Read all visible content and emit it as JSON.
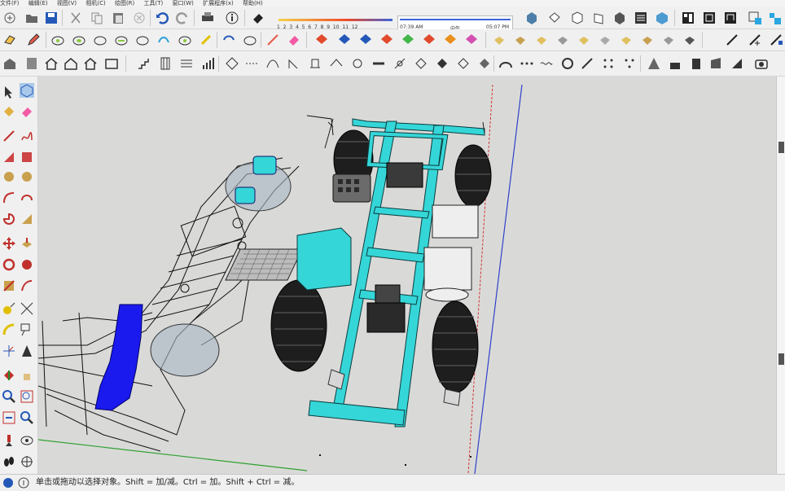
{
  "menu": [
    "文件(F)",
    "编辑(E)",
    "视图(V)",
    "相机(C)",
    "绘图(R)",
    "工具(T)",
    "窗口(W)",
    "扩展程序(x)",
    "帮助(H)"
  ],
  "shadow_months": [
    "1",
    "2",
    "3",
    "4",
    "5",
    "6",
    "7",
    "8",
    "9",
    "10",
    "11",
    "12"
  ],
  "shadow_times": {
    "start": "07:39 AM",
    "mid": "中午",
    "end": "05:07 PM"
  },
  "status_text": "单击或拖动以选择对象。Shift = 加/减。Ctrl = 加。Shift + Ctrl = 减。",
  "colors": {
    "frame": "#35d6d8",
    "blue": "#1a1aee",
    "line": "#111111",
    "ground": "#d9dad8"
  },
  "toolbar_icons": [
    "new-icon",
    "open-icon",
    "save-icon",
    "cut-icon",
    "copy-icon",
    "paste-icon",
    "erase-icon",
    "undo-icon",
    "redo-icon",
    "print-icon",
    "info-icon",
    "eraser-icon"
  ]
}
